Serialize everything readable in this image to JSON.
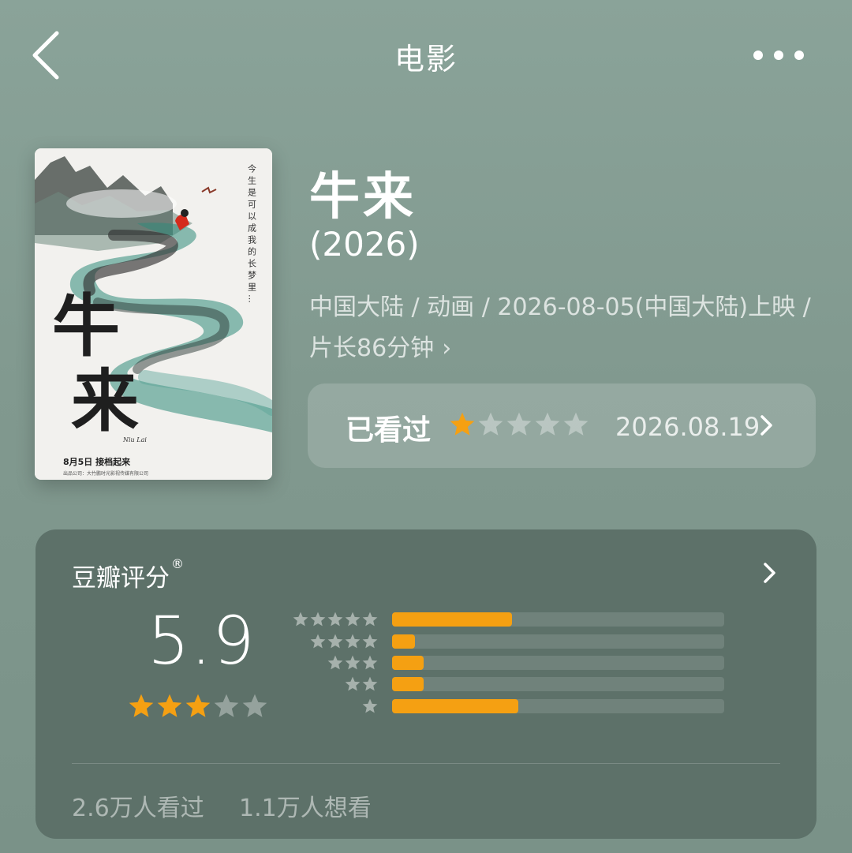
{
  "header": {
    "title": "电影",
    "back_icon": "chevron-left-icon",
    "more_icon": "ellipsis-icon"
  },
  "poster": {
    "vertical_text": "今生是可以成我的长梦里…",
    "title_glyph_1": "牛",
    "title_glyph_2": "来",
    "pinyin": "Niu Lai",
    "release_line": "8月5日  接档起来",
    "credit_line": "出品公司：大竹鹏时光影视传媒有限公司"
  },
  "movie": {
    "title": "牛来",
    "year": "(2026)",
    "meta": "中国大陆 / 动画 / 2026-08-05(中国大陆)上映 / 片长86分钟"
  },
  "watched": {
    "label": "已看过",
    "user_rating": 1,
    "max_rating": 5,
    "date": "2026.08.19"
  },
  "rating": {
    "heading": "豆瓣评分",
    "registered_mark": "®",
    "score": "5.9",
    "star_rating": 3,
    "max_stars": 5,
    "distribution": [
      {
        "stars": 5,
        "fraction": 0.36
      },
      {
        "stars": 4,
        "fraction": 0.07
      },
      {
        "stars": 3,
        "fraction": 0.095
      },
      {
        "stars": 2,
        "fraction": 0.095
      },
      {
        "stars": 1,
        "fraction": 0.38
      }
    ],
    "watched_count": "2.6万人看过",
    "wish_count": "1.1万人想看"
  },
  "colors": {
    "accent_star": "#f5a012",
    "star_empty": "rgba(255,255,255,0.35)",
    "dist_star": "rgba(255,255,255,0.45)"
  }
}
